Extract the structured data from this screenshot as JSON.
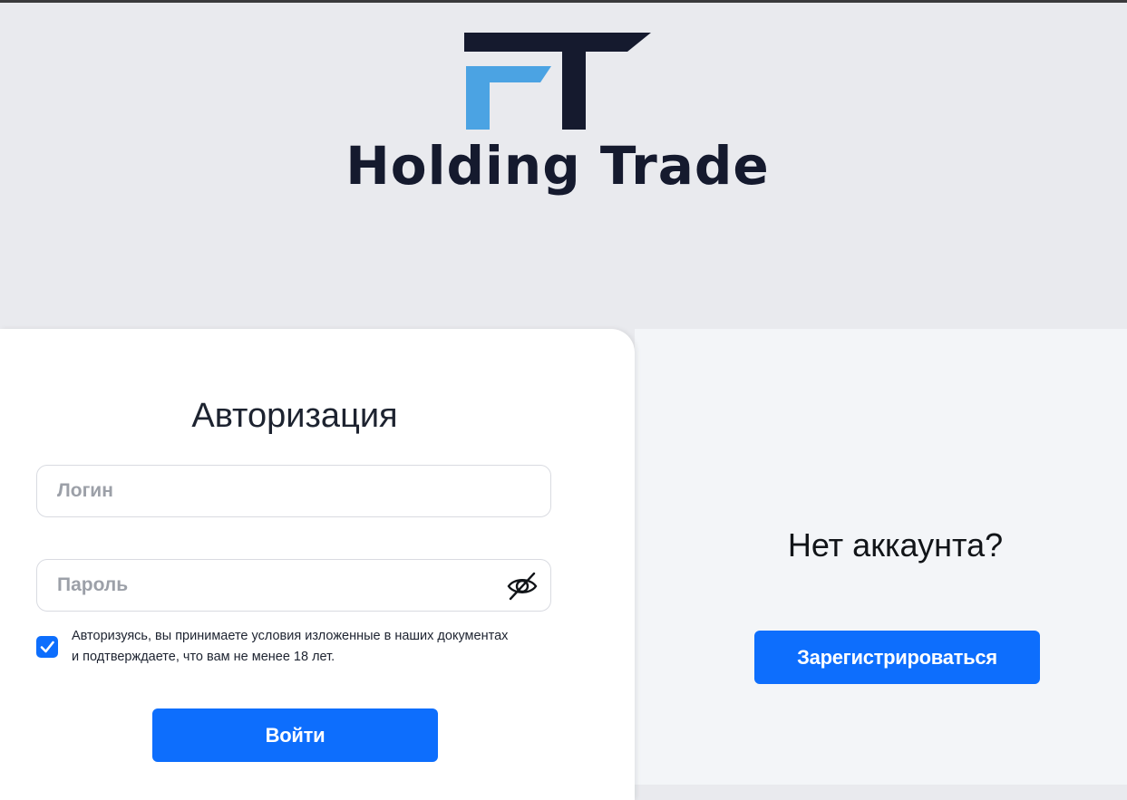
{
  "brand": {
    "name": "Holding Trade",
    "logo_icon": "ft-logo-icon",
    "colors": {
      "dark": "#151a2e",
      "accent": "#4ba3e3"
    }
  },
  "login": {
    "title": "Авторизация",
    "login_placeholder": "Логин",
    "login_value": "",
    "password_placeholder": "Пароль",
    "password_value": "",
    "password_toggle_icon": "eye-off-icon",
    "consent_checked": true,
    "consent_line1": "Авторизуясь, вы принимаете условия изложенные в наших документах",
    "consent_line2": "и подтверждаете, что вам не менее 18 лет.",
    "submit_label": "Войти"
  },
  "register": {
    "prompt": "Нет аккаунта?",
    "button_label": "Зарегистрироваться"
  },
  "colors": {
    "primary": "#0d6efd",
    "header_bg": "#e9eaee",
    "right_panel_bg": "#f3f5f8"
  }
}
